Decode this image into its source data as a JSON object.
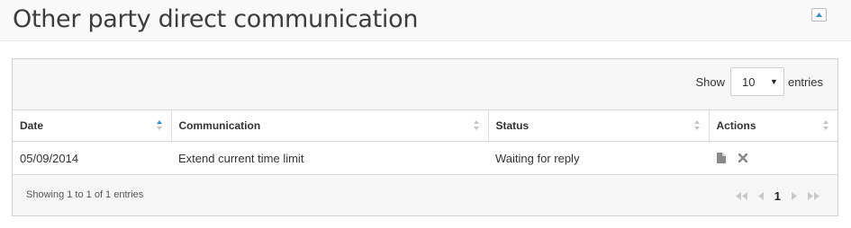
{
  "header": {
    "title": "Other party direct communication",
    "collapse_icon": "collapse-icon"
  },
  "length_control": {
    "prefix": "Show",
    "selected": "10",
    "suffix": "entries"
  },
  "table": {
    "columns": [
      {
        "label": "Date",
        "sorted": "asc"
      },
      {
        "label": "Communication",
        "sorted": "none"
      },
      {
        "label": "Status",
        "sorted": "none"
      },
      {
        "label": "Actions",
        "sorted": "none"
      }
    ],
    "rows": [
      {
        "date": "05/09/2014",
        "communication": "Extend current time limit",
        "status": "Waiting for reply",
        "actions": [
          "document-icon",
          "delete-icon"
        ]
      }
    ]
  },
  "footer": {
    "info": "Showing 1 to 1 of 1 entries",
    "current_page": "1",
    "pager_icons": [
      "first-page-icon",
      "previous-page-icon",
      "next-page-icon",
      "last-page-icon"
    ]
  },
  "colors": {
    "sort_active": "#3b8ec9",
    "icon_grey": "#c4c4c4",
    "action_icon": "#8a8a8a"
  }
}
